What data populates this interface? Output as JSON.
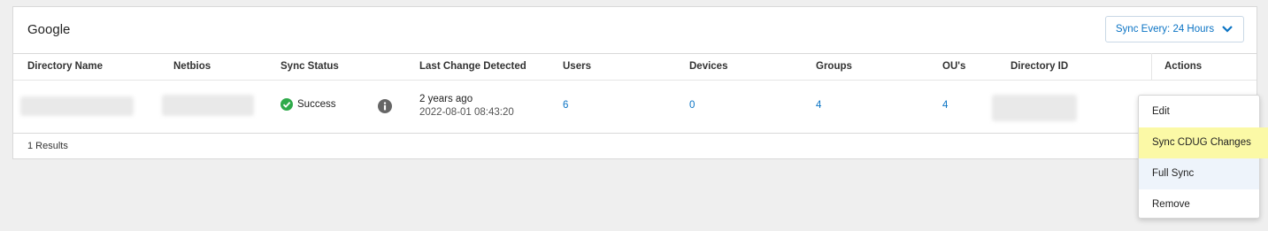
{
  "panel": {
    "title": "Google",
    "sync_button_label": "Sync Every: 24 Hours"
  },
  "table": {
    "headers": [
      "Directory Name",
      "Netbios",
      "Sync Status",
      "Last Change Detected",
      "Users",
      "Devices",
      "Groups",
      "OU's",
      "Directory ID",
      "Actions"
    ],
    "row": {
      "sync_status": "Success",
      "last_change_relative": "2 years ago",
      "last_change_timestamp": "2022-08-01 08:43:20",
      "users": "6",
      "devices": "0",
      "groups": "4",
      "ous": "4"
    },
    "results_text": "1 Results"
  },
  "actions_menu": {
    "items": [
      "Edit",
      "Sync CDUG Changes",
      "Full Sync",
      "Remove"
    ]
  },
  "colors": {
    "link": "#0a73c4",
    "success": "#2eaa4a",
    "highlight_yellow": "#fbf9a6",
    "highlight_blue": "#eef4fb"
  },
  "icons": [
    "chevron-down-icon",
    "success-check-icon",
    "info-icon"
  ]
}
